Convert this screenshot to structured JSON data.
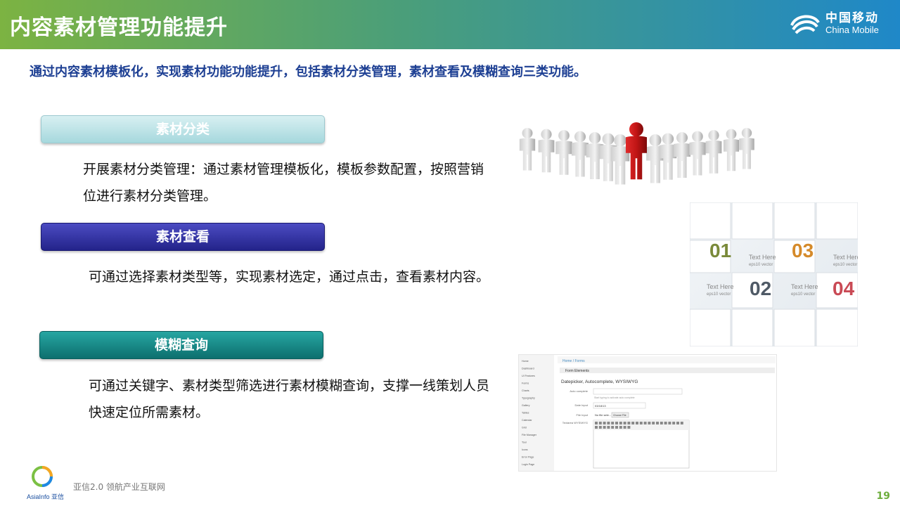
{
  "header": {
    "title": "内容素材管理功能提升",
    "brand_cn": "中国移动",
    "brand_en": "China Mobile"
  },
  "subtitle": "通过内容素材模板化，实现素材功能功能提升，包括素材分类管理，素材查看及模糊查询三类功能。",
  "sections": [
    {
      "label": "素材分类",
      "text": "开展素材分类管理：通过素材管理模板化，模板参数配置，按照营销位进行素材分类管理。"
    },
    {
      "label": "素材查看",
      "text": "可通过选择素材类型等，实现素材选定，通过点击，查看素材内容。"
    },
    {
      "label": "模糊查询",
      "text": "可通过关键字、素材类型筛选进行素材模糊查询，支撑一线策划人员快速定位所需素材。"
    }
  ],
  "number_card": {
    "items": [
      "01",
      "02",
      "03",
      "04"
    ],
    "caption": "Text Here",
    "caption_sub": "eps10 vector",
    "colors": [
      "#7a8a3a",
      "#4f5a66",
      "#d58a2a",
      "#c94a55"
    ]
  },
  "form_screenshot": {
    "breadcrumb": "Home / Forms",
    "panel_title": "Form Elements",
    "heading": "Datepicker, Autocomplete, WYSIWYG",
    "fields": [
      "Auto complete",
      "Date Input",
      "File Input",
      "Textarea WYSIWYG"
    ],
    "hint": "Start typing to activate auto complete",
    "date_value": "03/18/13",
    "file_value": "No file sele...",
    "file_button": "Choose File",
    "nav_items": [
      "Home",
      "Dashboard",
      "UI Features",
      "Forms",
      "Charts",
      "Typography",
      "Gallery",
      "Tables",
      "Calendar",
      "Grid",
      "File Manager",
      "Tour",
      "Icons",
      "Error Page",
      "Login Page"
    ]
  },
  "footer": {
    "text": "亚信2.0  领航产业互联网",
    "logo_text": "AsiaInfo 亚信",
    "page": "19"
  }
}
